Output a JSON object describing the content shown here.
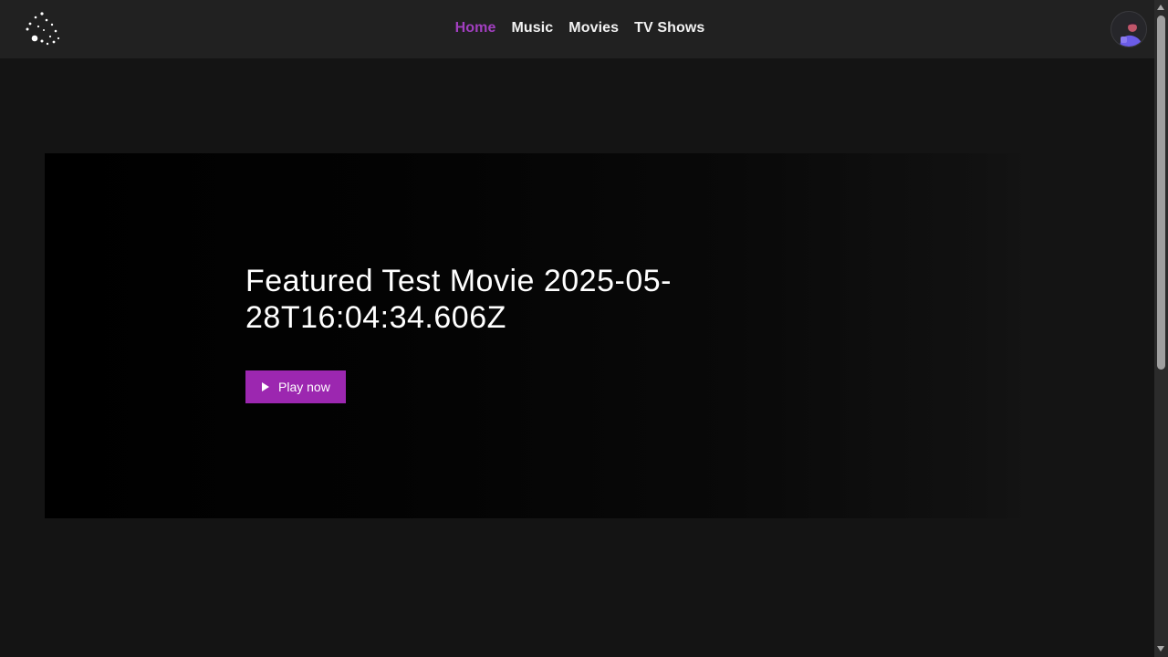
{
  "header": {
    "logo_icon": "dotted-spiral-logo",
    "nav": [
      {
        "label": "Home",
        "active": true
      },
      {
        "label": "Music",
        "active": false
      },
      {
        "label": "Movies",
        "active": false
      },
      {
        "label": "TV Shows",
        "active": false
      }
    ],
    "avatar_icon": "user-avatar-icon"
  },
  "hero": {
    "title": "Featured Test Movie 2025-05-28T16:04:34.606Z",
    "play_label": "Play now",
    "play_icon": "play-icon"
  },
  "colors": {
    "accent": "#9c27b0",
    "active_nav": "#a23fc0",
    "header_bg": "#212121",
    "page_bg": "#141414"
  }
}
